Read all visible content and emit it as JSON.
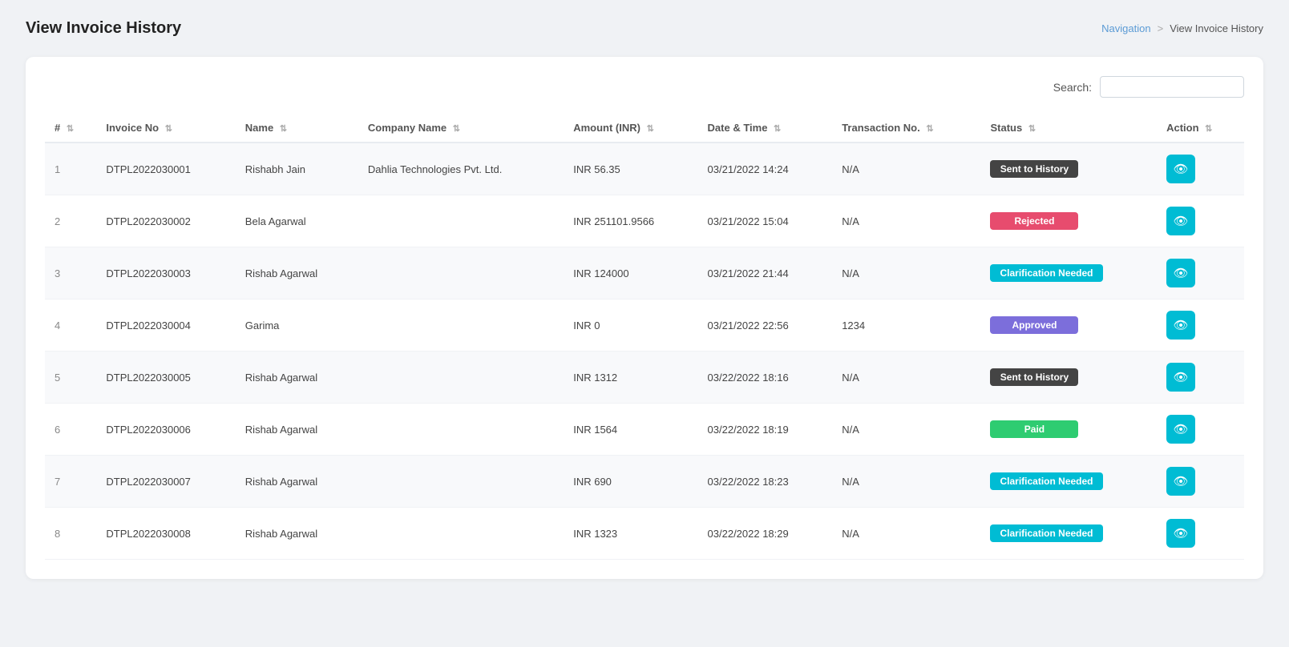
{
  "page": {
    "title": "View Invoice History",
    "breadcrumb": {
      "nav_label": "Navigation",
      "separator": ">",
      "current": "View Invoice History"
    }
  },
  "search": {
    "label": "Search:",
    "placeholder": ""
  },
  "table": {
    "columns": [
      {
        "id": "num",
        "label": "#",
        "sort": true
      },
      {
        "id": "invoice_no",
        "label": "Invoice No",
        "sort": true
      },
      {
        "id": "name",
        "label": "Name",
        "sort": true
      },
      {
        "id": "company_name",
        "label": "Company Name",
        "sort": true
      },
      {
        "id": "amount",
        "label": "Amount (INR)",
        "sort": true
      },
      {
        "id": "date_time",
        "label": "Date & Time",
        "sort": true
      },
      {
        "id": "transaction_no",
        "label": "Transaction No.",
        "sort": true
      },
      {
        "id": "status",
        "label": "Status",
        "sort": true
      },
      {
        "id": "action",
        "label": "Action",
        "sort": true
      }
    ],
    "rows": [
      {
        "num": "1",
        "invoice_no": "DTPL2022030001",
        "name": "Rishabh Jain",
        "company_name": "Dahlia Technologies Pvt. Ltd.",
        "amount": "INR 56.35",
        "date_time": "03/21/2022  14:24",
        "transaction_no": "N/A",
        "status": "Sent to History",
        "status_class": "status-sent-history"
      },
      {
        "num": "2",
        "invoice_no": "DTPL2022030002",
        "name": "Bela Agarwal",
        "company_name": "",
        "amount": "INR 251101.9566",
        "date_time": "03/21/2022  15:04",
        "transaction_no": "N/A",
        "status": "Rejected",
        "status_class": "status-rejected"
      },
      {
        "num": "3",
        "invoice_no": "DTPL2022030003",
        "name": "Rishab Agarwal",
        "company_name": "",
        "amount": "INR 124000",
        "date_time": "03/21/2022  21:44",
        "transaction_no": "N/A",
        "status": "Clarification Needed",
        "status_class": "status-clarification"
      },
      {
        "num": "4",
        "invoice_no": "DTPL2022030004",
        "name": "Garima",
        "company_name": "",
        "amount": "INR 0",
        "date_time": "03/21/2022  22:56",
        "transaction_no": "1234",
        "status": "Approved",
        "status_class": "status-approved"
      },
      {
        "num": "5",
        "invoice_no": "DTPL2022030005",
        "name": "Rishab Agarwal",
        "company_name": "",
        "amount": "INR 1312",
        "date_time": "03/22/2022  18:16",
        "transaction_no": "N/A",
        "status": "Sent to History",
        "status_class": "status-sent-history"
      },
      {
        "num": "6",
        "invoice_no": "DTPL2022030006",
        "name": "Rishab Agarwal",
        "company_name": "",
        "amount": "INR 1564",
        "date_time": "03/22/2022  18:19",
        "transaction_no": "N/A",
        "status": "Paid",
        "status_class": "status-paid"
      },
      {
        "num": "7",
        "invoice_no": "DTPL2022030007",
        "name": "Rishab Agarwal",
        "company_name": "",
        "amount": "INR 690",
        "date_time": "03/22/2022  18:23",
        "transaction_no": "N/A",
        "status": "Clarification Needed",
        "status_class": "status-clarification"
      },
      {
        "num": "8",
        "invoice_no": "DTPL2022030008",
        "name": "Rishab Agarwal",
        "company_name": "",
        "amount": "INR 1323",
        "date_time": "03/22/2022  18:29",
        "transaction_no": "N/A",
        "status": "Clarification Needed",
        "status_class": "status-clarification"
      }
    ]
  }
}
